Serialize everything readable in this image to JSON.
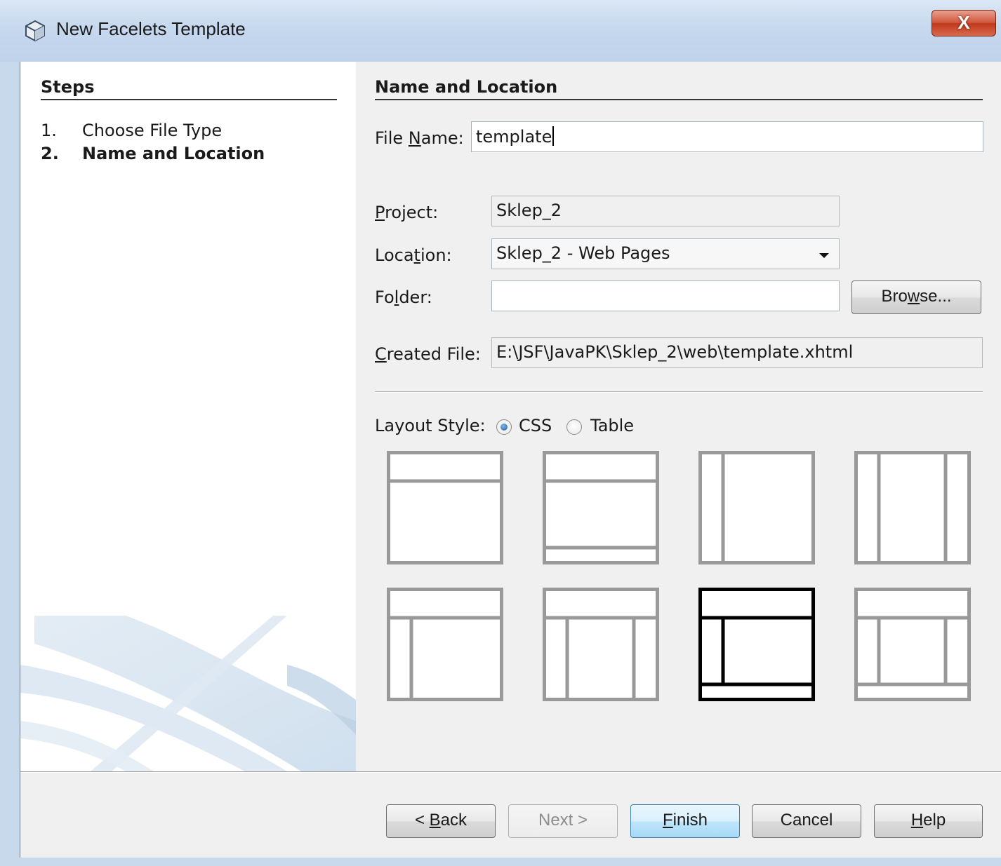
{
  "window": {
    "title": "New Facelets Template",
    "close_label": "X"
  },
  "steps": {
    "header": "Steps",
    "items": [
      {
        "number": "1.",
        "label": "Choose File Type",
        "current": false
      },
      {
        "number": "2.",
        "label": "Name and Location",
        "current": true
      }
    ]
  },
  "section": {
    "title": "Name and Location"
  },
  "form": {
    "file_name": {
      "label_pre": "File ",
      "label_mnemonic": "N",
      "label_post": "ame:",
      "value": "template"
    },
    "project": {
      "label_pre": "",
      "label_mnemonic": "P",
      "label_post": "roject:",
      "value": "Sklep_2"
    },
    "location": {
      "label_pre": "Loca",
      "label_mnemonic": "t",
      "label_post": "ion:",
      "value": "Sklep_2 - Web Pages"
    },
    "folder": {
      "label_pre": "Fo",
      "label_mnemonic": "l",
      "label_post": "der:",
      "value": ""
    },
    "browse_button": {
      "pre": "Bro",
      "mnemonic": "w",
      "post": "se..."
    },
    "created_file": {
      "label_pre": "",
      "label_mnemonic": "C",
      "label_post": "reated File:",
      "value": "E:\\JSF\\JavaPK\\Sklep_2\\web\\template.xhtml"
    }
  },
  "layout_style": {
    "label": "Layout Style:",
    "options": [
      {
        "label": "CSS",
        "selected": true
      },
      {
        "label": "Table",
        "selected": false
      }
    ],
    "templates": [
      {
        "name": "header-content",
        "selected": false
      },
      {
        "name": "header-content-footer",
        "selected": false
      },
      {
        "name": "left-content",
        "selected": false
      },
      {
        "name": "left-content-right",
        "selected": false
      },
      {
        "name": "header-left-content",
        "selected": false
      },
      {
        "name": "header-left-content-right",
        "selected": false
      },
      {
        "name": "header-left-content-footer",
        "selected": true
      },
      {
        "name": "header-left-content-right-footer",
        "selected": false
      }
    ]
  },
  "buttons": {
    "back": {
      "pre": "< ",
      "mnemonic": "B",
      "post": "ack",
      "enabled": true
    },
    "next": {
      "label": "Next >",
      "enabled": false
    },
    "finish": {
      "pre": "",
      "mnemonic": "F",
      "post": "inish",
      "enabled": true
    },
    "cancel": {
      "label": "Cancel",
      "enabled": true
    },
    "help": {
      "pre": "",
      "mnemonic": "H",
      "post": "elp",
      "enabled": true
    }
  },
  "colors": {
    "icon_gray": "#999999",
    "icon_selected": "#000000"
  }
}
